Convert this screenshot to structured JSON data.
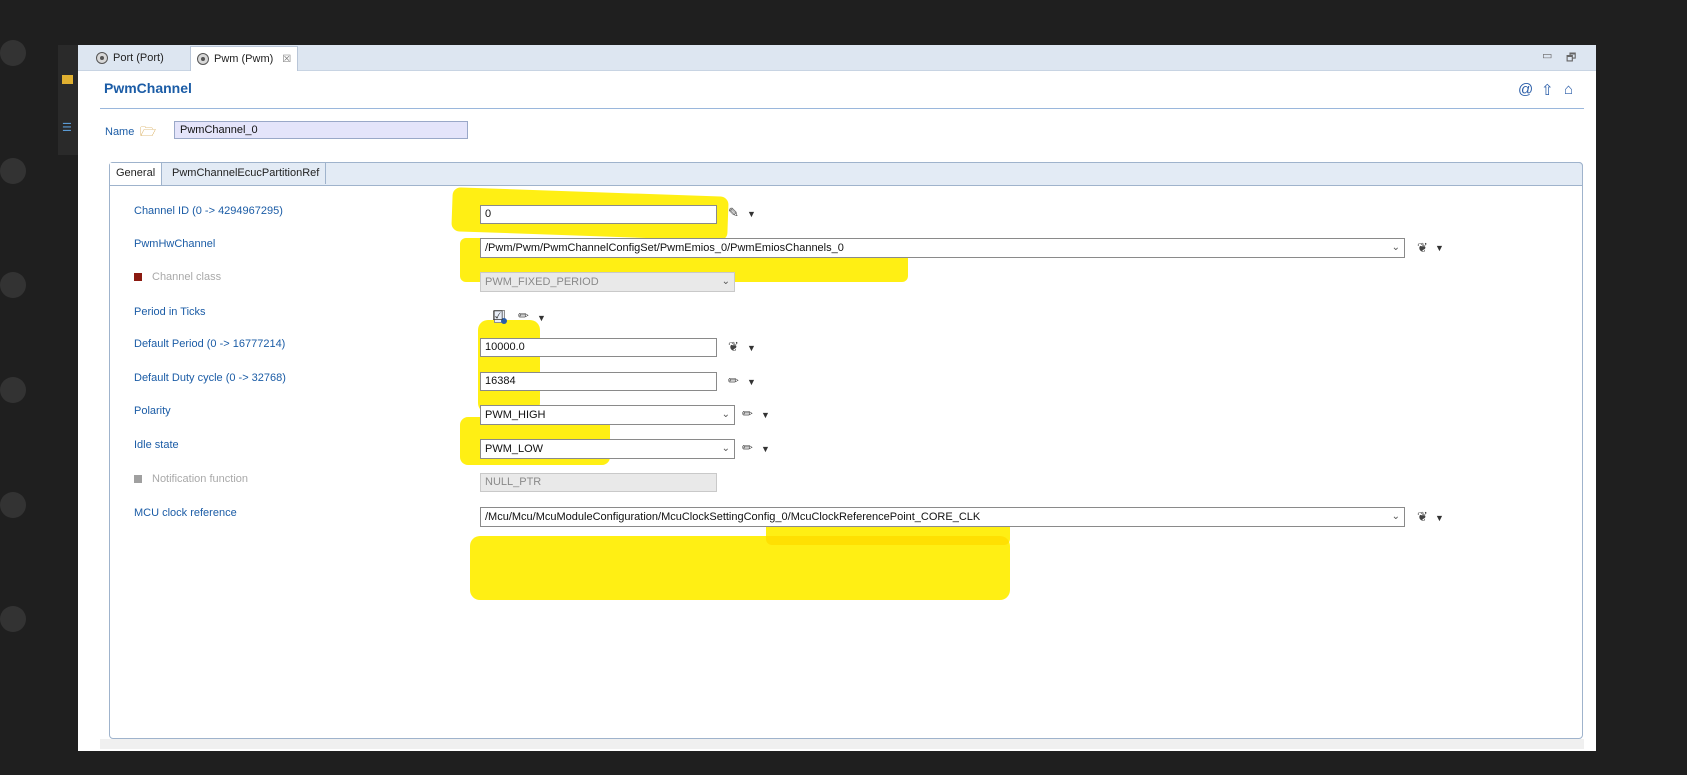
{
  "tabs": [
    {
      "label": "Port (Port)",
      "active": false
    },
    {
      "label": "Pwm (Pwm)",
      "active": true,
      "close": "☒"
    }
  ],
  "header": {
    "title": "PwmChannel"
  },
  "name_field": {
    "label": "Name",
    "value": "PwmChannel_0"
  },
  "form_tabs": [
    "General",
    "PwmChannelEcucPartitionRef"
  ],
  "fields": {
    "channel_id": {
      "label": "Channel ID (0 -> 4294967295)",
      "value": "0"
    },
    "hw_channel": {
      "label": "PwmHwChannel",
      "value": "/Pwm/Pwm/PwmChannelConfigSet/PwmEmios_0/PwmEmiosChannels_0"
    },
    "channel_class": {
      "label": "Channel class",
      "value": "PWM_FIXED_PERIOD"
    },
    "period_in_ticks": {
      "label": "Period in Ticks",
      "checked": true
    },
    "default_period": {
      "label": "Default Period (0 -> 16777214)",
      "value": "10000.0"
    },
    "default_duty": {
      "label": "Default Duty cycle (0 -> 32768)",
      "value": "16384"
    },
    "polarity": {
      "label": "Polarity",
      "value": "PWM_HIGH"
    },
    "idle_state": {
      "label": "Idle state",
      "value": "PWM_LOW"
    },
    "notification": {
      "label": "Notification function",
      "value": "NULL_PTR"
    },
    "mcu_clock_ref": {
      "label": "MCU clock reference",
      "value": "/Mcu/Mcu/McuModuleConfiguration/McuClockSettingConfig_0/McuClockReferencePoint_CORE_CLK"
    }
  },
  "colors": {
    "highlight": "#ffee00",
    "label_blue": "#1b5ca6",
    "channel_class_marker": "#8b1a10",
    "notification_marker": "#a0a0a0"
  }
}
